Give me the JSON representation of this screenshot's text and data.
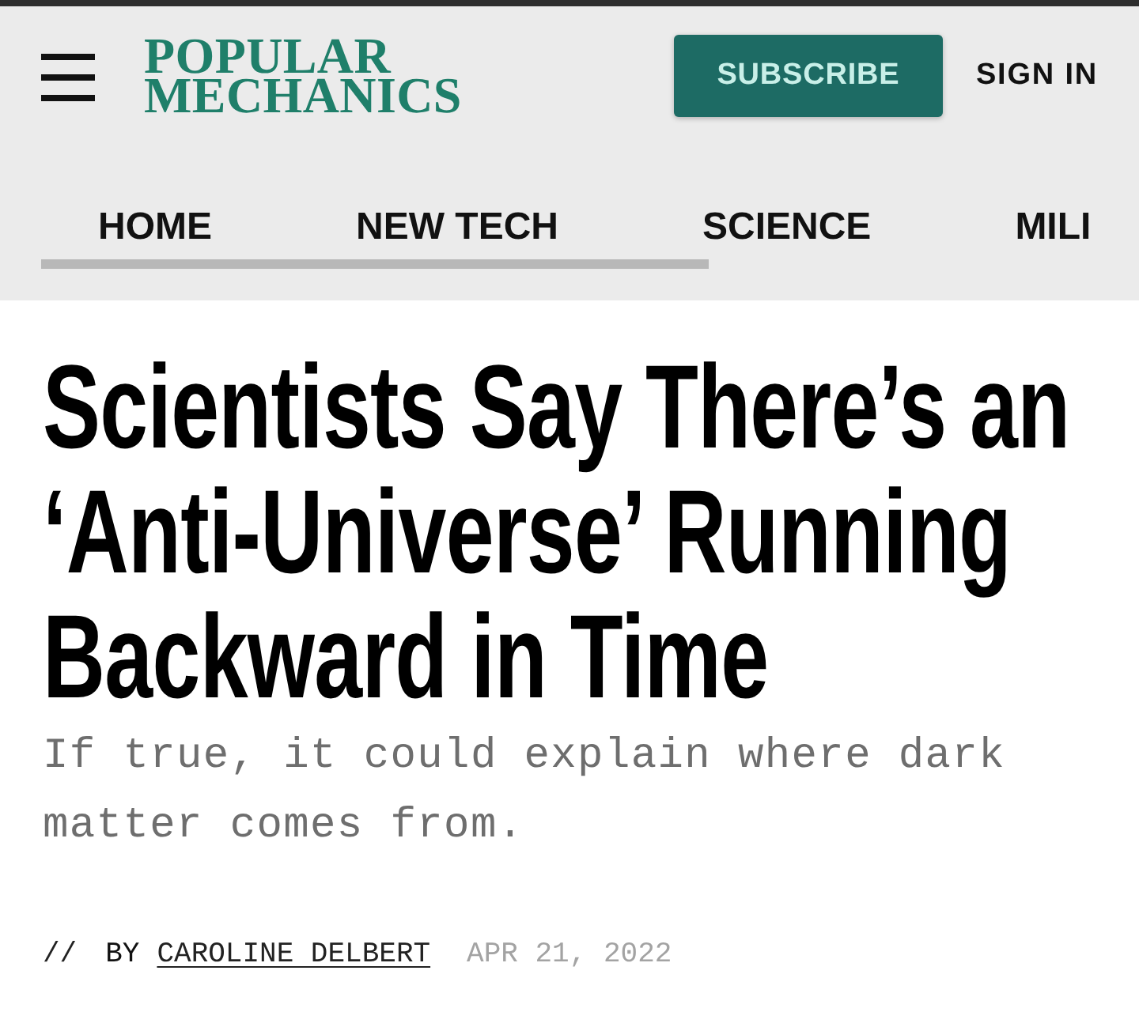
{
  "header": {
    "logo": {
      "line_1": "POPULAR",
      "line_2": "MECHANICS"
    },
    "subscribe_button": "SUBSCRIBE",
    "sign_in": "SIGN IN"
  },
  "nav": {
    "items": [
      "HOME",
      "NEW TECH",
      "SCIENCE",
      "MILI"
    ]
  },
  "article": {
    "headline": "Scientists Say There’s an ‘Anti-Universe’ Running Backward in Time",
    "dek": "If true, it could explain where dark matter comes from.",
    "byline": {
      "separator": "//",
      "label": "BY",
      "author": "CAROLINE DELBERT",
      "date": "APR 21, 2022"
    }
  }
}
